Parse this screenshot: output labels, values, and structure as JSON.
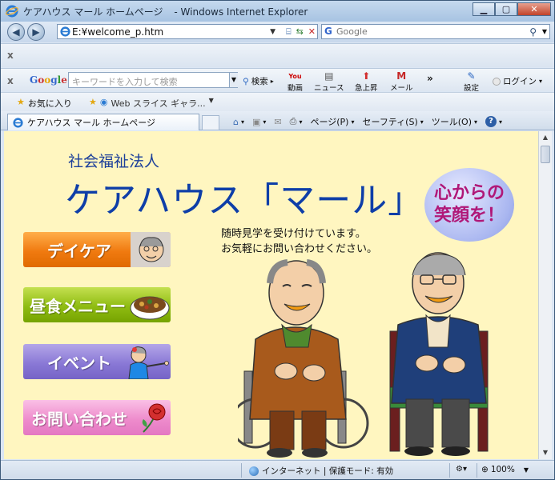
{
  "window": {
    "title": "ケアハウス マール ホームページ",
    "app_name": "- Windows Internet Explorer"
  },
  "address_bar": {
    "url": "E:¥welcome_p.htm"
  },
  "search_box": {
    "placeholder": "Google"
  },
  "google_toolbar": {
    "logo": "Google",
    "search_placeholder": "キーワードを入力して検索",
    "search_label": "検索",
    "video_label": "動画",
    "youtube_label": "You",
    "news_label": "ニュース",
    "rising_label": "急上昇",
    "mail_label": "メール",
    "more_label": "»",
    "settings_label": "設定",
    "login_label": "ログイン"
  },
  "favorites": {
    "favorites_label": "お気に入り",
    "web_slice_label": "Web スライス ギャラ..."
  },
  "tab": {
    "label": "ケアハウス マール ホームページ"
  },
  "command_bar": {
    "page_label": "ページ(P)",
    "safety_label": "セーフティ(S)",
    "tools_label": "ツール(O)",
    "help_label": "?"
  },
  "content": {
    "org_type": "社会福祉法人",
    "brand_name": "ケアハウス「マール」",
    "notice_line1": "随時見学を受け付けています。",
    "notice_line2": "お気軽にお問い合わせください。",
    "slogan_line1": "心からの",
    "slogan_line2": "笑顔を！",
    "menu": [
      {
        "label": "デイケア",
        "color": "#f07a10"
      },
      {
        "label": "昼食メニュー",
        "color": "#8fbc12"
      },
      {
        "label": "イベント",
        "color": "#8a79d6"
      },
      {
        "label": "お問い合わせ",
        "color": "#ee8ccc"
      }
    ]
  },
  "status_bar": {
    "zone": "インターネット | 保護モード: 有効",
    "zoom": "100%"
  }
}
